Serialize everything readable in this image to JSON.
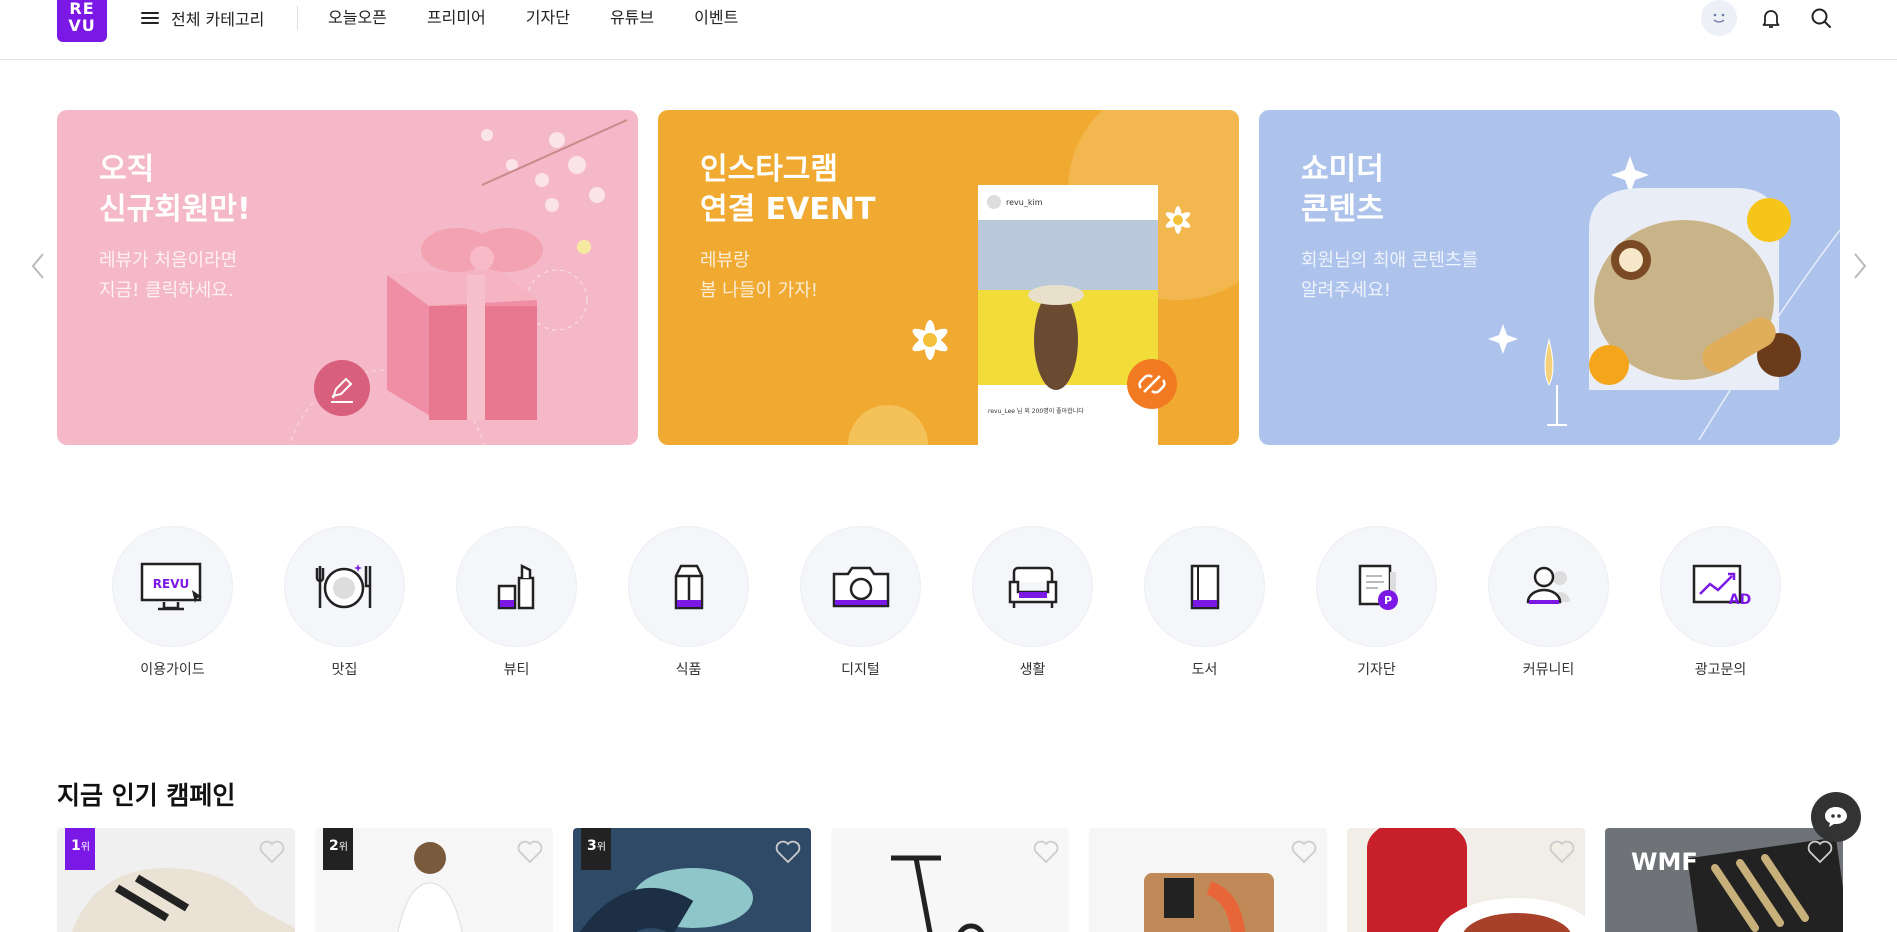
{
  "header": {
    "logo_text": "RE\nVU",
    "all_categories": "전체 카테고리",
    "nav": [
      "오늘오픈",
      "프리미어",
      "기자단",
      "유튜브",
      "이벤트"
    ]
  },
  "banners": [
    {
      "title": "오직\n신규회원만!",
      "subtitle": "레뷰가 처음이라면\n지금! 클릭하세요."
    },
    {
      "title": "인스타그램\n연결 EVENT",
      "subtitle": "레뷰랑\n봄 나들이 가자!",
      "insta_user": "revu_kim",
      "insta_caption": "revu_Lee 님 외 200명이 좋아합니다"
    },
    {
      "title": "쇼미더\n콘텐츠",
      "subtitle": "회원님의 최애 콘텐츠를\n알려주세요!"
    }
  ],
  "categories": [
    {
      "label": "이용가이드",
      "icon": "monitor-revu-icon"
    },
    {
      "label": "맛집",
      "icon": "plate-icon"
    },
    {
      "label": "뷰티",
      "icon": "lipstick-icon"
    },
    {
      "label": "식품",
      "icon": "milk-carton-icon"
    },
    {
      "label": "디지털",
      "icon": "camera-icon"
    },
    {
      "label": "생활",
      "icon": "sofa-icon"
    },
    {
      "label": "도서",
      "icon": "book-icon"
    },
    {
      "label": "기자단",
      "icon": "document-p-icon"
    },
    {
      "label": "커뮤니티",
      "icon": "people-icon"
    },
    {
      "label": "광고문의",
      "icon": "chart-ad-icon"
    }
  ],
  "popular": {
    "title": "지금 인기 캠페인",
    "cards": [
      {
        "rank": "1",
        "rank_suffix": "위",
        "color": "#7c18e6"
      },
      {
        "rank": "2",
        "rank_suffix": "위",
        "color": "#222222"
      },
      {
        "rank": "3",
        "rank_suffix": "위",
        "color": "#222222"
      },
      {
        "rank": "",
        "rank_suffix": ""
      },
      {
        "rank": "",
        "rank_suffix": ""
      },
      {
        "rank": "",
        "rank_suffix": ""
      },
      {
        "rank": "",
        "rank_suffix": "",
        "brand": "WMF"
      }
    ]
  },
  "colors": {
    "brand": "#7c18e6",
    "banner1": "#f5b8c8",
    "banner2": "#f0aa32",
    "banner3": "#aec3ec"
  }
}
